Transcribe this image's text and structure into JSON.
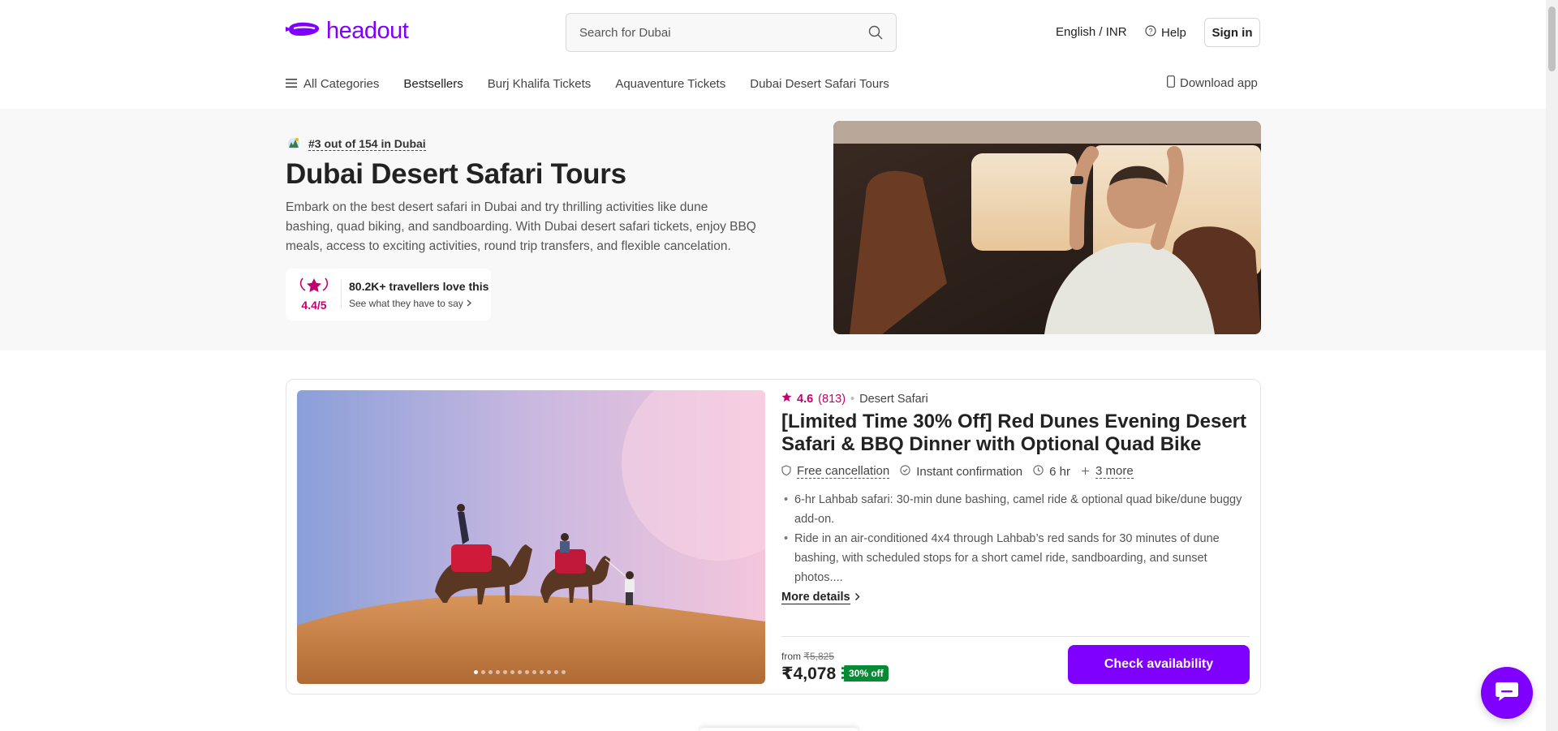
{
  "header": {
    "logo_text": "headout",
    "search_placeholder": "Search for Dubai",
    "language_currency": "English / INR",
    "help_label": "Help",
    "signin_label": "Sign in"
  },
  "nav": {
    "all_categories": "All Categories",
    "items": [
      "Bestsellers",
      "Burj Khalifa Tickets",
      "Aquaventure Tickets",
      "Dubai Desert Safari Tours"
    ],
    "download_app": "Download app"
  },
  "hero": {
    "rank": "#3 out of 154 in Dubai",
    "title": "Dubai Desert Safari Tours",
    "description": "Embark on the best desert safari in Dubai and try thrilling activities like dune bashing, quad biking, and sandboarding. With Dubai desert safari tickets, enjoy BBQ meals, access to exciting activities, round trip transfers, and flexible cancelation.",
    "rating_score": "4.4/5",
    "travellers_text": "80.2K+ travellers love this",
    "see_reviews": "See what they have to say"
  },
  "product": {
    "rating": "4.6",
    "review_count": "(813)",
    "category": "Desert Safari",
    "title": "[Limited Time 30% Off] Red Dunes Evening Desert Safari & BBQ Dinner with Optional Quad Bike",
    "features": {
      "free_cancellation": "Free cancellation",
      "instant_confirmation": "Instant confirmation",
      "duration": "6 hr",
      "more": "3 more"
    },
    "bullets": [
      "6-hr Lahbab safari: 30-min dune bashing, camel ride & optional quad bike/dune buggy add-on.",
      "Ride in an air-conditioned 4x4 through Lahbab’s red sands for 30 minutes of dune bashing, with scheduled stops for a short camel ride, sandboarding, and sunset photos...."
    ],
    "more_details": "More details",
    "from_label": "from",
    "original_price": "₹5,825",
    "price": "₹4,078",
    "discount": "30% off",
    "cta": "Check availability",
    "carousel_total": 13,
    "carousel_active": 1
  },
  "colors": {
    "brand": "#8000ff",
    "rating_pink": "#c4006e",
    "discount_green": "#078a36"
  },
  "icons": [
    "headout-logo-icon",
    "search-icon",
    "help-icon",
    "menu-icon",
    "phone-icon",
    "laurel-star-icon",
    "chevron-right-icon",
    "star-icon",
    "shield-icon",
    "check-circle-icon",
    "clock-icon",
    "plus-icon",
    "chat-icon"
  ]
}
